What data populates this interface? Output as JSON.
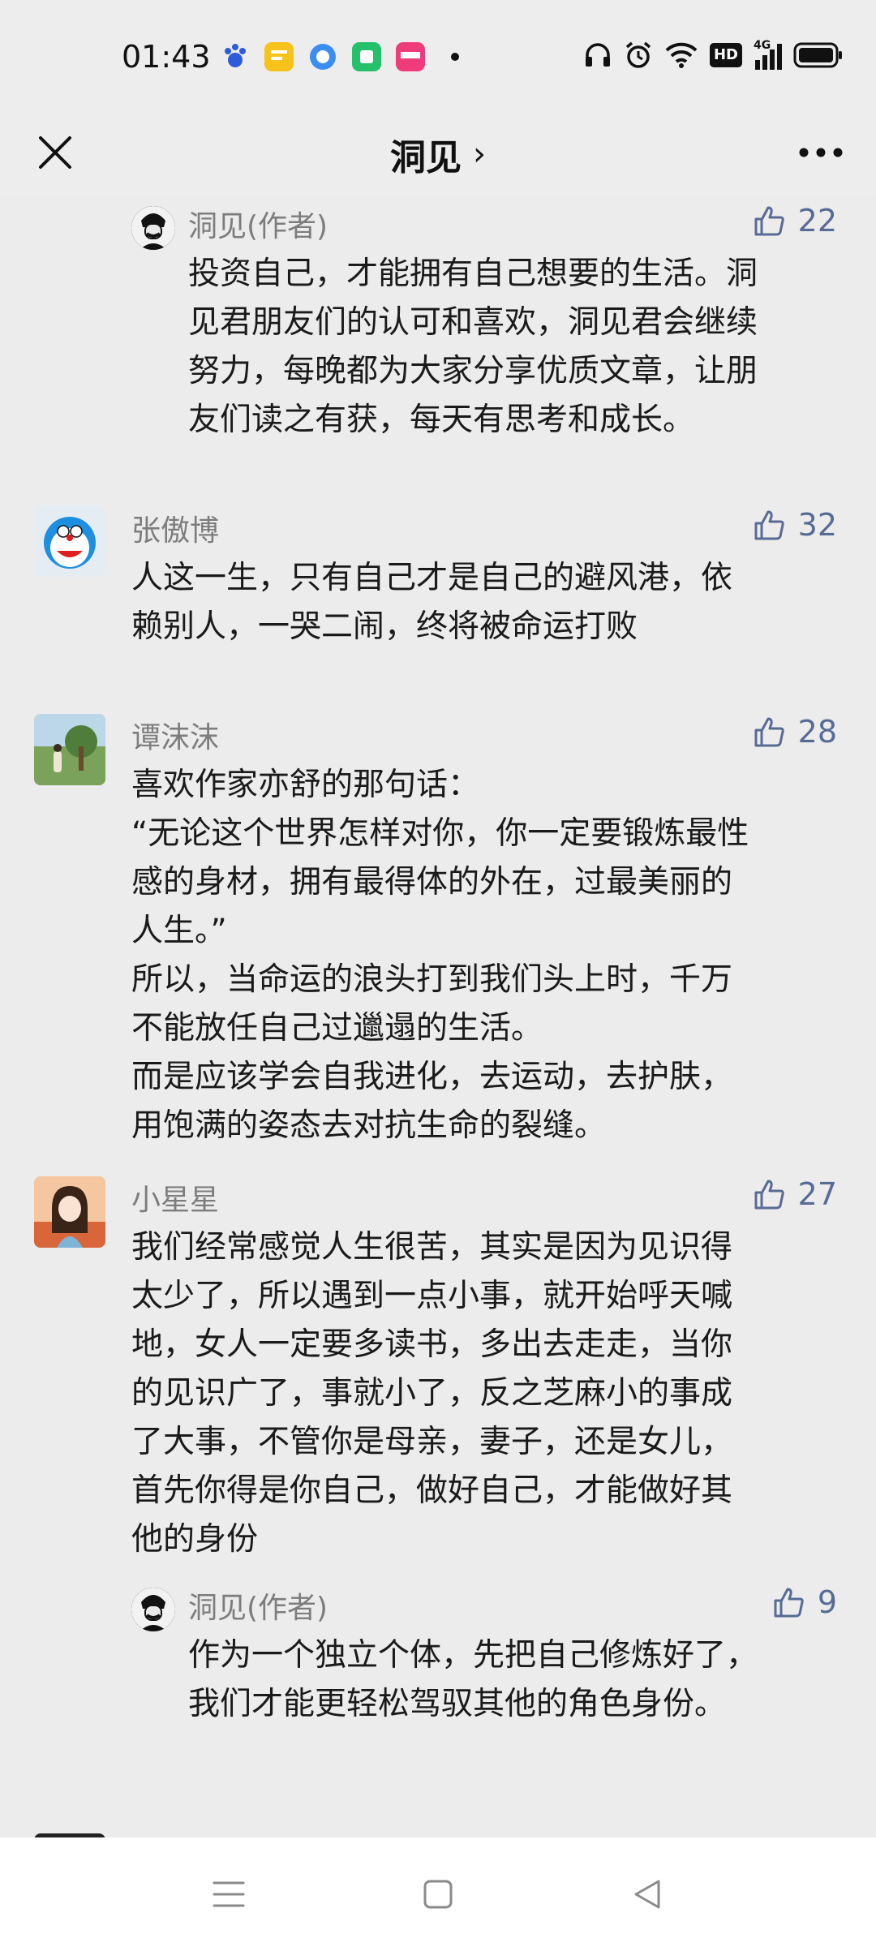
{
  "status": {
    "time": "01:43",
    "notification_icons": [
      "baidu-icon",
      "notes-icon",
      "browser-icon",
      "app-store-icon",
      "shop-icon"
    ],
    "system_icons": [
      "headphones-icon",
      "alarm-icon",
      "wifi-icon",
      "hd-icon",
      "signal-4g-icon",
      "battery-icon"
    ],
    "network_label": "4G",
    "hd_label": "HD"
  },
  "nav": {
    "title": "洞见",
    "title_chevron": "›"
  },
  "comments": [
    {
      "type": "reply",
      "name": "洞见(作者)",
      "likes": "22",
      "text": "投资自己，才能拥有自己想要的生活。洞\n见君朋友们的认可和喜欢，洞见君会继续\n努力，每晚都为大家分享优质文章，让朋\n友们读之有获，每天有思考和成长。"
    },
    {
      "type": "comment",
      "name": "张傲博",
      "likes": "32",
      "text": "人这一生，只有自己才是自己的避风港，依\n赖别人，一哭二闹，终将被命运打败"
    },
    {
      "type": "comment",
      "name": "谭沫沫",
      "likes": "28",
      "text": "喜欢作家亦舒的那句话：\n“无论这个世界怎样对你，你一定要锻炼最性\n感的身材，拥有最得体的外在，过最美丽的\n人生。”\n所以，当命运的浪头打到我们头上时，千万\n不能放任自己过邋遢的生活。\n而是应该学会自我进化，去运动，去护肤，\n用饱满的姿态去对抗生命的裂缝。"
    },
    {
      "type": "comment",
      "name": "小星星",
      "likes": "27",
      "text": "我们经常感觉人生很苦，其实是因为见识得\n太少了，所以遇到一点小事，就开始呼天喊\n地，女人一定要多读书，多出去走走，当你\n的见识广了，事就小了，反之芝麻小的事成\n了大事，不管你是母亲，妻子，还是女儿，\n首先你得是你自己，做好自己，才能做好其\n他的身份"
    },
    {
      "type": "reply",
      "name": "洞见(作者)",
      "likes": "9",
      "text": "作为一个独立个体，先把自己修炼好了，\n我们才能更轻松驾驭其他的角色身份。"
    }
  ],
  "colors": {
    "background": "#ededed",
    "like_blue": "#576b95",
    "name_gray": "#7d7d7d",
    "text": "#1a1a1a"
  },
  "bottom_nav": [
    "menu-icon",
    "home-square-icon",
    "back-triangle-icon"
  ]
}
